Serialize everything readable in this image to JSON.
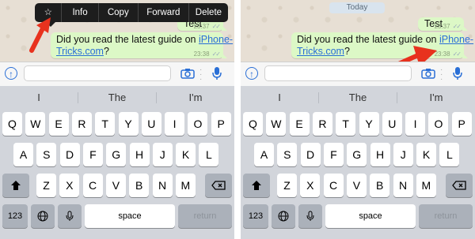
{
  "left": {
    "context_menu": [
      "☆",
      "Info",
      "Copy",
      "Forward",
      "Delete"
    ],
    "messages": {
      "test_text": "Test",
      "test_time": "23:37",
      "main_line1": "Did you read the latest guide on ",
      "main_link1": "iPhone-",
      "main_link2": "Tricks.com",
      "main_line2_end": "?",
      "main_time": "23:38"
    }
  },
  "right": {
    "date_pill": "Today",
    "messages": {
      "test_text": "Test",
      "test_time": "23:37",
      "main_line1": "Did you read the latest guide on ",
      "main_link1": "iPhone-",
      "main_link2": "Tricks.com",
      "main_line2_end": "?",
      "main_time": "23:38",
      "star": "★"
    }
  },
  "keyboard": {
    "suggestions": [
      "I",
      "The",
      "I'm"
    ],
    "row1": [
      "Q",
      "W",
      "E",
      "R",
      "T",
      "Y",
      "U",
      "I",
      "O",
      "P"
    ],
    "row2": [
      "A",
      "S",
      "D",
      "F",
      "G",
      "H",
      "J",
      "K",
      "L"
    ],
    "row3": [
      "Z",
      "X",
      "C",
      "V",
      "B",
      "N",
      "M"
    ],
    "num_key": "123",
    "space_key": "space",
    "return_key": "return"
  },
  "colors": {
    "bubble": "#dcf8c6",
    "link": "#2a6fd6",
    "arrow": "#e8321e",
    "keyboard_bg": "#d2d5db"
  },
  "icons": [
    "star-icon",
    "plus-icon",
    "camera-icon",
    "more-dots-icon",
    "microphone-icon",
    "shift-icon",
    "backspace-icon",
    "globe-icon",
    "check-icon"
  ]
}
